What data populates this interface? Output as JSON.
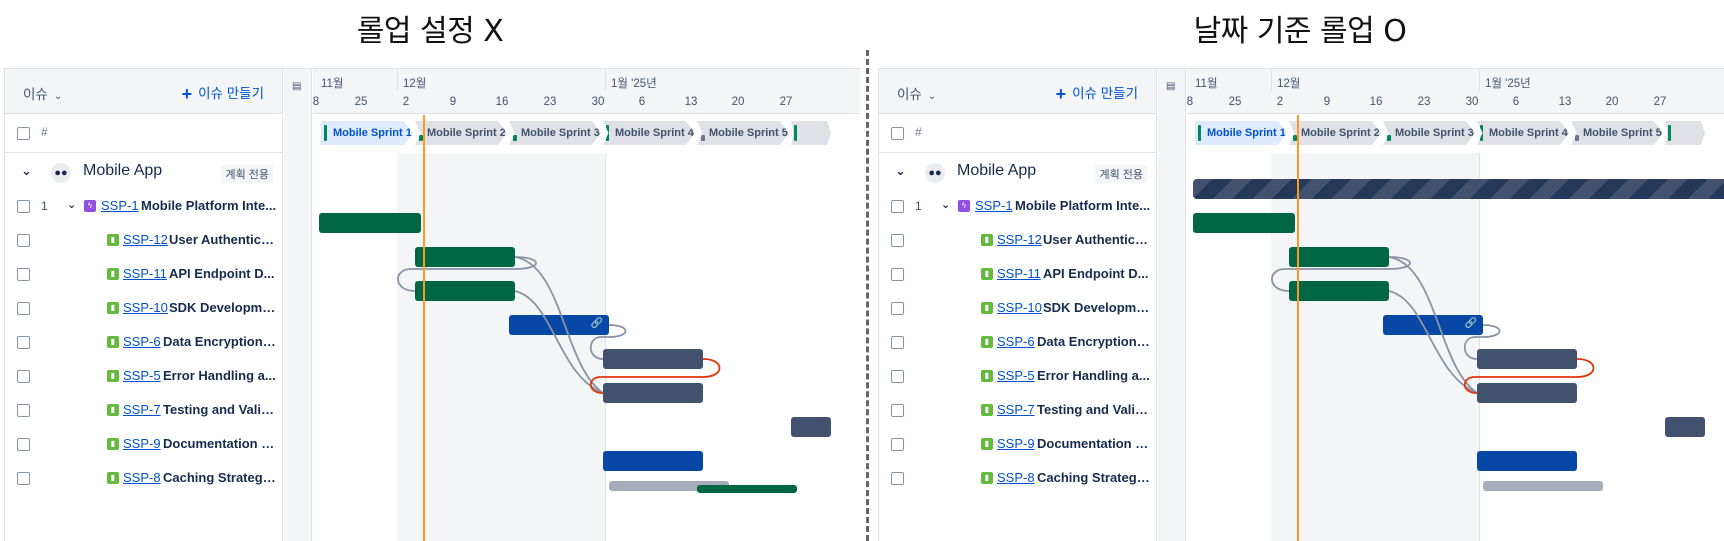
{
  "captions": {
    "left": "롤업 설정 X",
    "right": "날짜 기준 롤업 O"
  },
  "header": {
    "issue_filter": "이슈",
    "create_issue": "이슈 만들기",
    "hash_label": "#",
    "strip_icon": "timeline-icon"
  },
  "timeline": {
    "months": [
      "11월",
      "12월",
      "1월 '25년"
    ],
    "days": [
      "8",
      "25",
      "2",
      "9",
      "16",
      "23",
      "30",
      "6",
      "13",
      "20",
      "27"
    ]
  },
  "epic": {
    "name": "Mobile App",
    "plan_badge": "계획 전용"
  },
  "sprints": [
    "Mobile Sprint 1",
    "Mobile Sprint 2",
    "Mobile Sprint 3",
    "Mobile Sprint 4",
    "Mobile Sprint 5"
  ],
  "rows": [
    {
      "num": "1",
      "key": "SSP-1",
      "summary": "Mobile Platform Inte...",
      "type": "epic"
    },
    {
      "key": "SSP-12",
      "summary": "User Authentica...",
      "type": "story"
    },
    {
      "key": "SSP-11",
      "summary": "API Endpoint D...",
      "type": "story"
    },
    {
      "key": "SSP-10",
      "summary": "SDK Developme...",
      "type": "story"
    },
    {
      "key": "SSP-6",
      "summary": "Data Encryption I...",
      "type": "story"
    },
    {
      "key": "SSP-5",
      "summary": "Error Handling a...",
      "type": "story"
    },
    {
      "key": "SSP-7",
      "summary": "Testing and Valid...",
      "type": "story"
    },
    {
      "key": "SSP-9",
      "summary": "Documentation a...",
      "type": "story"
    },
    {
      "key": "SSP-8",
      "summary": "Caching Strategy...",
      "type": "story"
    }
  ],
  "colors": {
    "done": "#006644",
    "in_progress": "#0747a6",
    "todo": "#42526e",
    "today_line": "#ff991f",
    "conflict_link": "#de350b"
  }
}
